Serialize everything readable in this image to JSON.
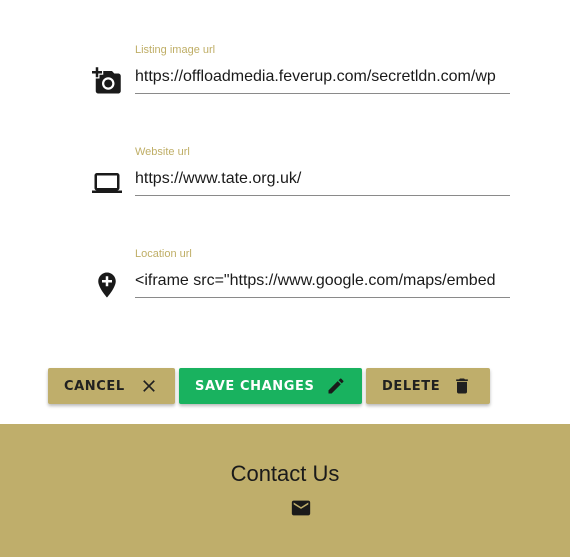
{
  "form": {
    "fields": [
      {
        "label": "Listing image url",
        "value": "https://offloadmedia.feverup.com/secretldn.com/wp",
        "icon": "add-a-photo-icon"
      },
      {
        "label": "Website url",
        "value": "https://www.tate.org.uk/",
        "icon": "laptop-icon"
      },
      {
        "label": "Location url",
        "value": "<iframe src=\"https://www.google.com/maps/embed",
        "icon": "add-location-icon"
      }
    ]
  },
  "actions": {
    "cancel_label": "CANCEL",
    "save_label": "SAVE CHANGES",
    "delete_label": "DELETE"
  },
  "footer": {
    "title": "Contact Us",
    "icon": "mail-icon"
  },
  "colors": {
    "accent_gold": "#bfae6b",
    "label_gold": "#bfae66",
    "save_green": "#19b25f"
  }
}
